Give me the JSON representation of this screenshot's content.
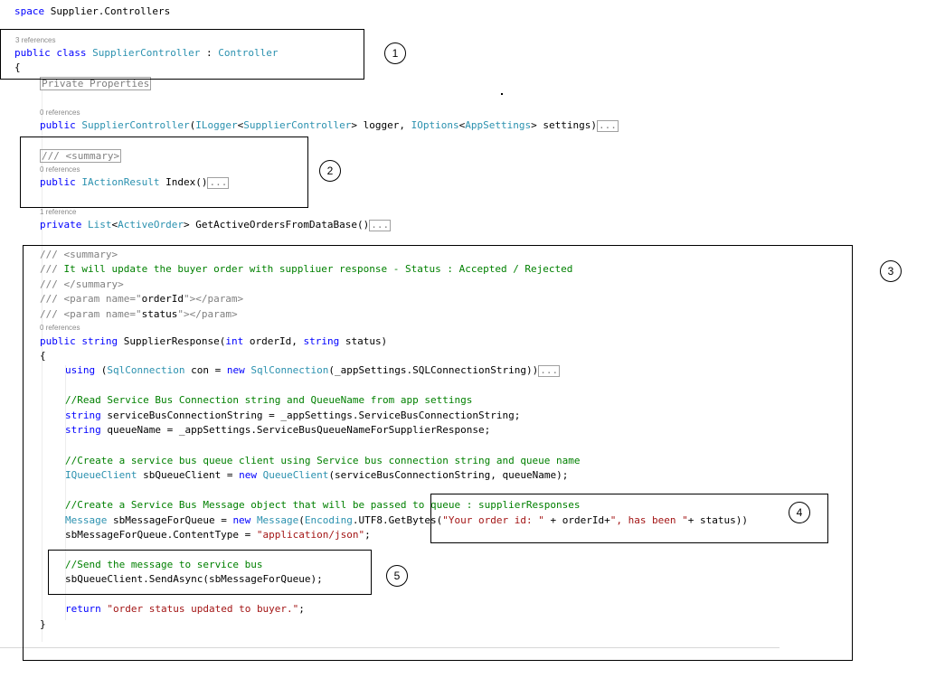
{
  "namespace": {
    "keyword": "space",
    "name": "Supplier.Controllers"
  },
  "class_decl": {
    "refs": "3 references",
    "kw1": "public",
    "kw2": "class",
    "name": "SupplierController",
    "sep": " : ",
    "base": "Controller",
    "brace": "{"
  },
  "private_props": "Private Properties",
  "ctor": {
    "refs": "0 references",
    "kw": "public",
    "name": "SupplierController",
    "p1": "(",
    "t1": "ILogger",
    "lt": "<",
    "t2": "SupplierController",
    "p2": "> logger, ",
    "t3": "IOptions",
    "lt2": "<",
    "t4": "AppSettings",
    "p3": "> settings)",
    "ellipsis": "..."
  },
  "index_method": {
    "summary": "/// <summary>",
    "refs": "0 references",
    "kw": "public",
    "type": "IActionResult",
    "name": " Index()",
    "ellipsis": "..."
  },
  "get_orders": {
    "refs": "1 reference",
    "kw": "private",
    "type1": "List",
    "lt": "<",
    "type2": "ActiveOrder",
    "rest": "> GetActiveOrdersFromDataBase()",
    "ellipsis": "..."
  },
  "supplier_response": {
    "doc1": "/// <summary>",
    "doc2_prefix": "/// ",
    "doc2_text": "It will update the buyer order with suppliuer response - Status : Accepted / Rejected",
    "doc3": "/// </summary>",
    "doc4_prefix": "/// <param name=\"",
    "doc4_name": "orderId",
    "doc4_suffix": "\"></param>",
    "doc5_prefix": "/// <param name=\"",
    "doc5_name": "status",
    "doc5_suffix": "\"></param>",
    "refs": "0 references",
    "sig_kw1": "public",
    "sig_kw2": "string",
    "sig_name": " SupplierResponse(",
    "sig_kw3": "int",
    "sig_p1": " orderId, ",
    "sig_kw4": "string",
    "sig_p2": " status)",
    "open_brace": "{",
    "using_kw": "using",
    "using_a": " (",
    "using_t1": "SqlConnection",
    "using_b": " con = ",
    "using_new": "new",
    "using_c": " ",
    "using_t2": "SqlConnection",
    "using_d": "(_appSettings.SQLConnectionString))",
    "using_ellipsis": "...",
    "c1": "//Read Service Bus Connection string and QueueName from app settings",
    "l1_kw": "string",
    "l1_rest": " serviceBusConnectionString = _appSettings.ServiceBusConnectionString;",
    "l2_kw": "string",
    "l2_rest": " queueName = _appSettings.ServiceBusQueueNameForSupplierResponse;",
    "c2": "//Create a service bus queue client using Service bus connection string and queue name",
    "l3_t1": "IQueueClient",
    "l3_a": " sbQueueClient = ",
    "l3_new": "new",
    "l3_b": " ",
    "l3_t2": "QueueClient",
    "l3_c": "(serviceBusConnectionString, queueName);",
    "c3": "//Create a Service Bus Message object that will be passed to queue : supplierResponses",
    "l4_t1": "Message",
    "l4_a": " sbMessageForQueue = ",
    "l4_new": "new",
    "l4_b": " ",
    "l4_t2": "Message",
    "l4_c": "(",
    "l4_t3": "Encoding",
    "l4_d": ".UTF8.GetBytes(",
    "l4_s1": "\"Your order id: \"",
    "l4_e": " + orderId+",
    "l4_s2": "\", has been \"",
    "l4_f": "+ status))",
    "l5_a": "sbMessageForQueue.ContentType = ",
    "l5_s": "\"application/json\"",
    "l5_b": ";",
    "c4": "//Send the message to service bus",
    "l6": "sbQueueClient.SendAsync(sbMessageForQueue);",
    "ret_kw": "return",
    "ret_sp": " ",
    "ret_s": "\"order status updated to buyer.\"",
    "ret_end": ";",
    "close_brace": "}"
  },
  "markers": [
    "1",
    "2",
    "3",
    "4",
    "5"
  ]
}
